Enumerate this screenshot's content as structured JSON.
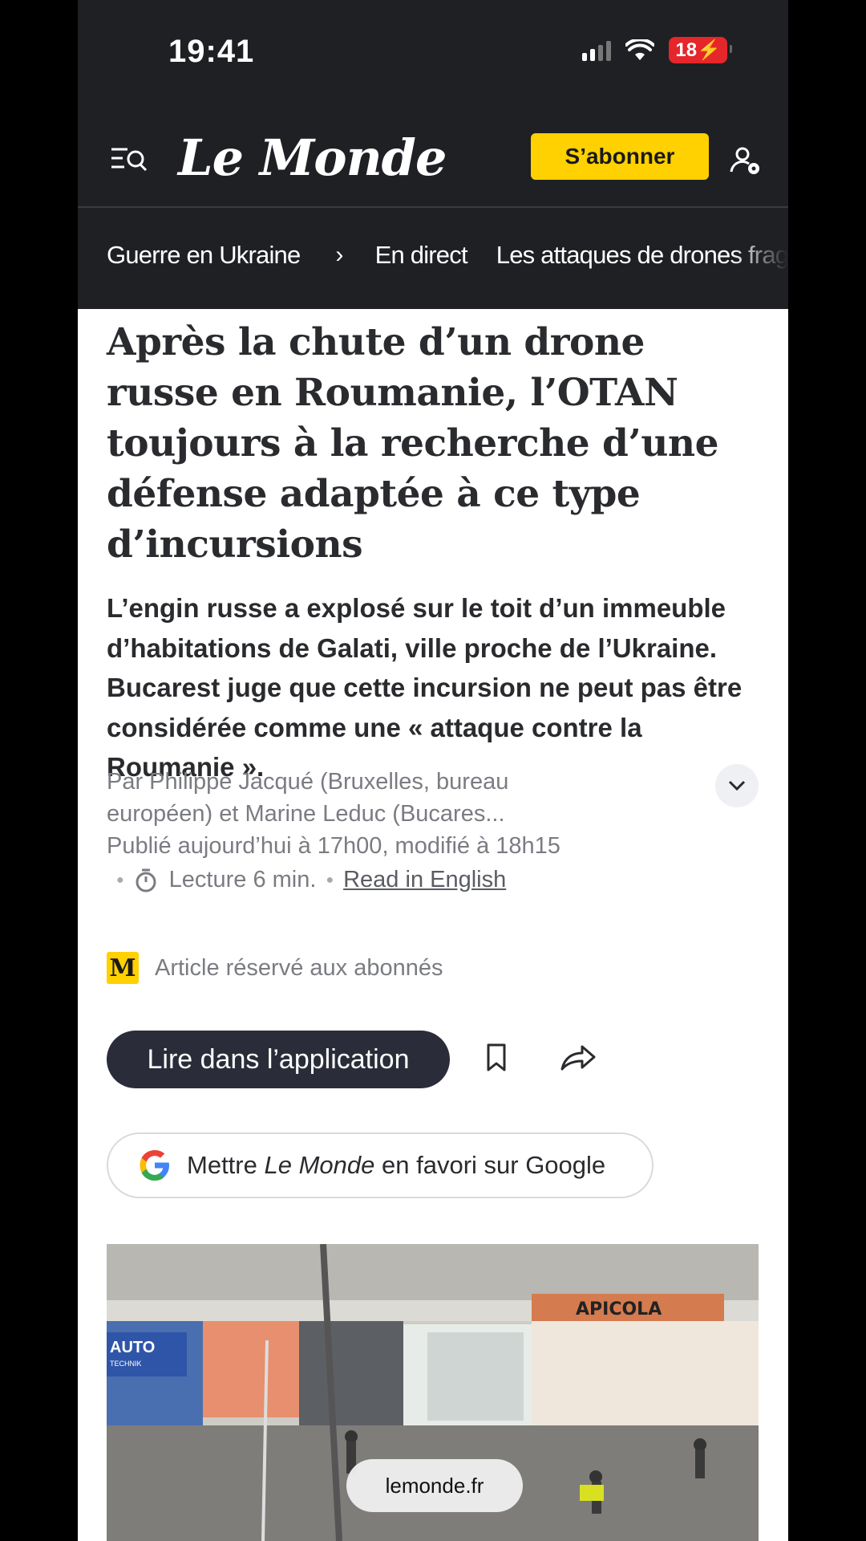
{
  "status_bar": {
    "time": "19:41",
    "battery": "18"
  },
  "header": {
    "logo": "Le Monde",
    "subscribe_label": "S’abonner"
  },
  "nav": {
    "items": [
      "Guerre en Ukraine",
      "En direct",
      "Les attaques de drones frag"
    ]
  },
  "article": {
    "title": "Après la chute d’un drone russe en Roumanie, l’OTAN toujours à la recherche d’une défense adaptée à ce type d’incursions",
    "lead": "L’engin russe a explosé sur le toit d’un immeuble d’habitations de Galati, ville proche de l’Ukraine. Bucarest juge que cette incursion ne peut pas être considérée comme une « attaque contre la Roumanie ».",
    "byline_line1": "Par Philippe Jacqué (Bruxelles, bureau",
    "byline_line2": "européen) et Marine Leduc (Bucares...",
    "published": "Publié aujourd’hui à 17h00, modifié à 18h15",
    "reading_time": "Lecture 6 min.",
    "read_in_english": "Read in English",
    "subscribers_label": "Article réservé aux abonnés",
    "badge_letter": "M"
  },
  "actions": {
    "app_button": "Lire dans l’application",
    "google_prefix": "Mettre",
    "google_brand": "Le Monde",
    "google_suffix": "en favori sur Google"
  },
  "photo": {
    "shop_sign": "APICOLA",
    "sign_left": "AUTO",
    "sign_left_sub": "TECHNIK"
  },
  "browser": {
    "domain": "lemonde.fr"
  },
  "colors": {
    "header_bg": "#1f2023",
    "subscribe": "#ffd100",
    "app_button": "#2a2d39",
    "battery": "#e5262b"
  }
}
